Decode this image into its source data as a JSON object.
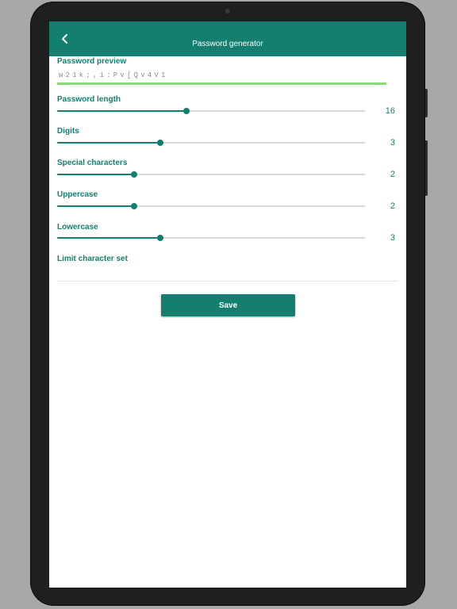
{
  "app": {
    "title": "Password generator",
    "back_icon": "chevron-left-icon"
  },
  "preview": {
    "label": "Password preview",
    "value": "w21k;,i:Pv[Qv4V1"
  },
  "sliders": [
    {
      "key": "length",
      "label": "Password length",
      "value": "16",
      "fraction": 0.42
    },
    {
      "key": "digits",
      "label": "Digits",
      "value": "3",
      "fraction": 0.335
    },
    {
      "key": "special",
      "label": "Special characters",
      "value": "2",
      "fraction": 0.25
    },
    {
      "key": "uppercase",
      "label": "Uppercase",
      "value": "2",
      "fraction": 0.25
    },
    {
      "key": "lowercase",
      "label": "Lowercase",
      "value": "3",
      "fraction": 0.335
    }
  ],
  "limit": {
    "label": "Limit character set"
  },
  "actions": {
    "save_label": "Save"
  },
  "colors": {
    "accent": "#13806f",
    "preview_underline": "#8bd97a",
    "track": "#d9d9d9"
  }
}
